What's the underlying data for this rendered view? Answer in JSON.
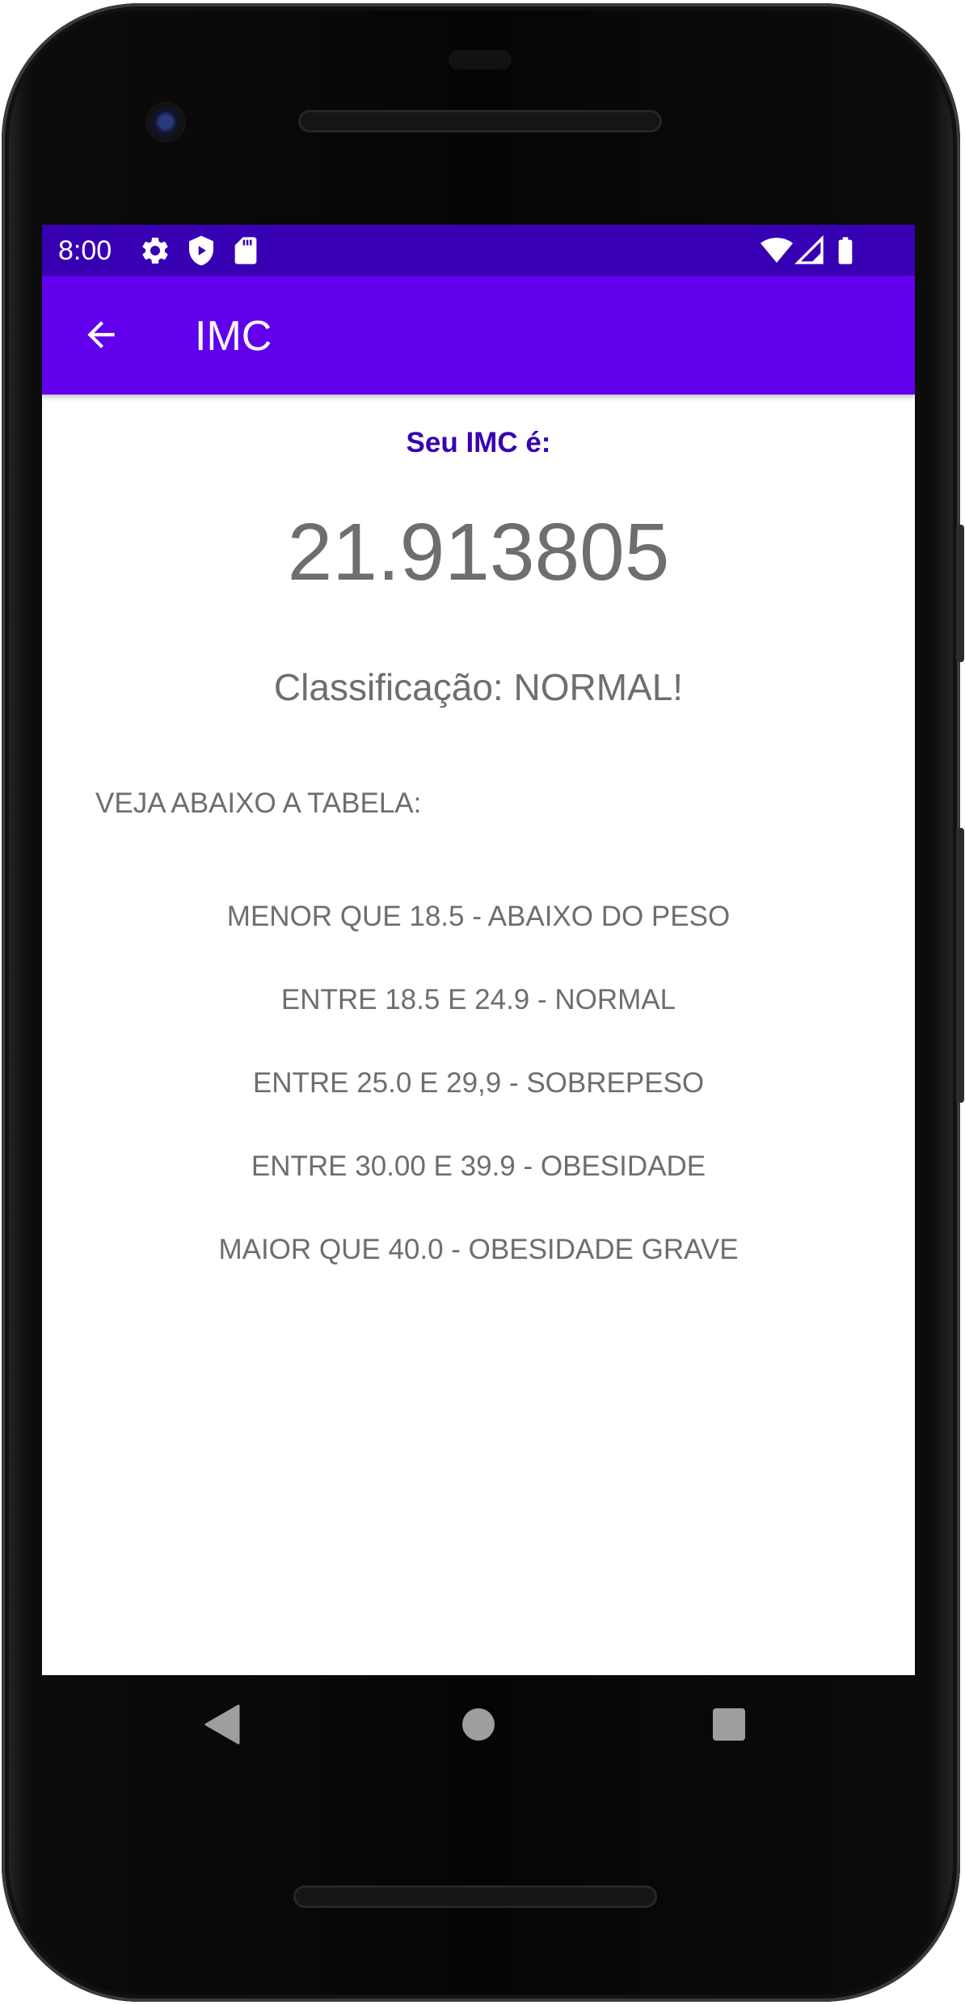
{
  "status_bar": {
    "time": "8:00",
    "left_icons": [
      "settings-icon",
      "shield-icon",
      "sd-card-icon"
    ],
    "right_icons": [
      "wifi-icon",
      "cell-signal-icon",
      "battery-icon"
    ],
    "color": "#3700b3"
  },
  "app_bar": {
    "title": "IMC",
    "back_icon": "arrow-back-icon",
    "color": "#6200ee"
  },
  "result": {
    "label": "Seu IMC é:",
    "value": "21.913805",
    "classification": "Classificação: NORMAL!"
  },
  "table": {
    "heading": "VEJA ABAIXO A TABELA:",
    "rows": [
      "MENOR QUE 18.5 - ABAIXO DO PESO",
      "ENTRE 18.5 E 24.9 - NORMAL",
      "ENTRE 25.0 E 29,9 - SOBREPESO",
      "ENTRE 30.00 E 39.9 - OBESIDADE",
      "MAIOR QUE 40.0 - OBESIDADE GRAVE"
    ]
  },
  "nav_bar": {
    "buttons": [
      "back-triangle-icon",
      "home-circle-icon",
      "recents-square-icon"
    ]
  },
  "colors": {
    "label_text": "#3700b3",
    "body_text": "#6e6e6e"
  }
}
